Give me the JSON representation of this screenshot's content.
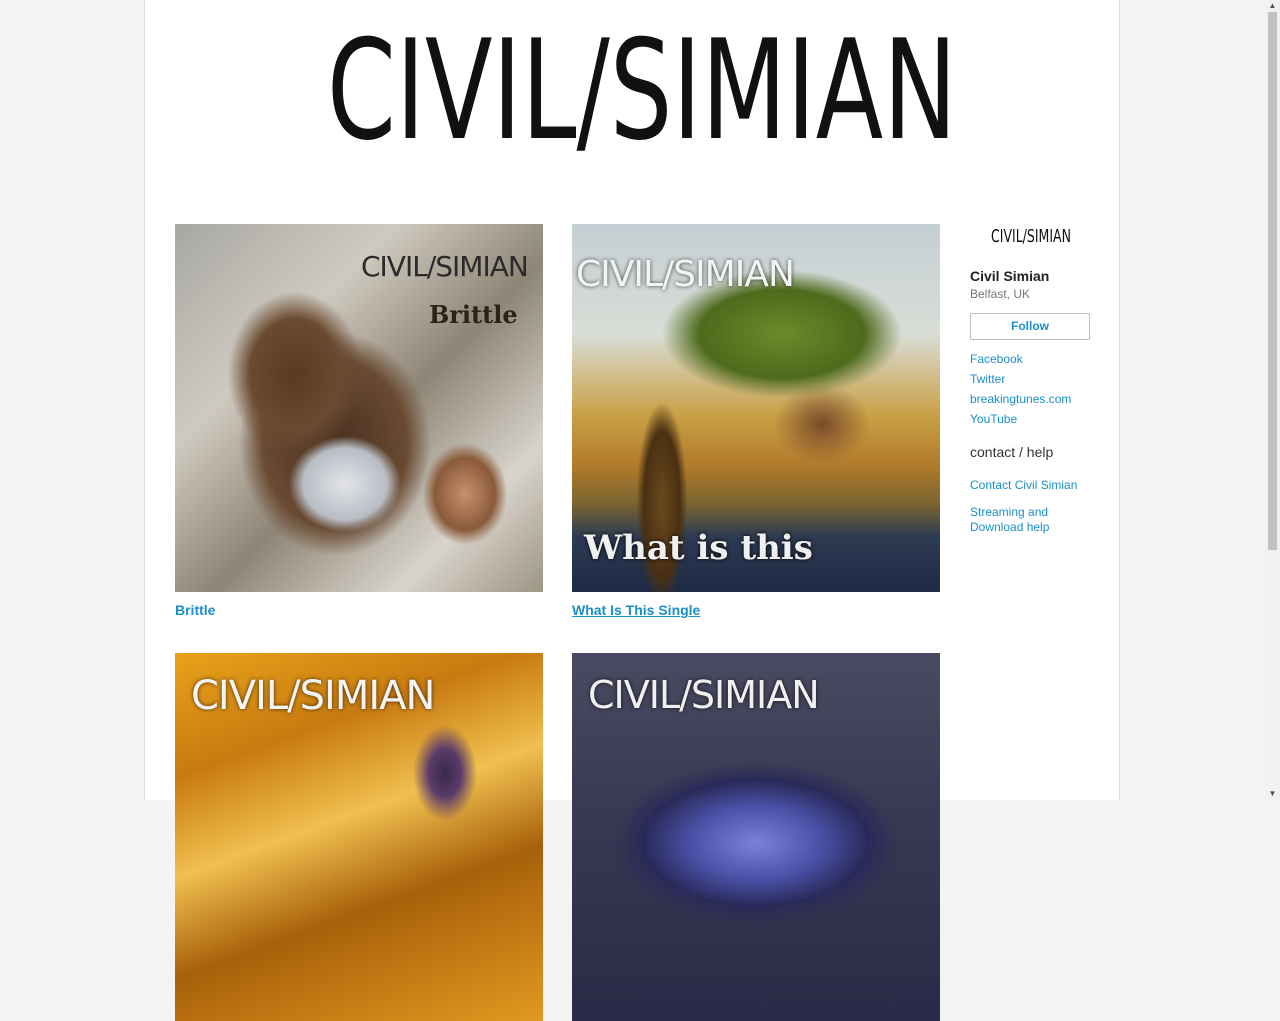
{
  "header": {
    "logo_text": "CIVIL/SIMIAN"
  },
  "albums": [
    {
      "title": "Brittle",
      "art_logo": "CIVIL/SIMIAN",
      "art_subtitle": "Brittle"
    },
    {
      "title": "What Is This Single",
      "art_logo": "CIVIL/SIMIAN",
      "art_subtitle": "What is this"
    },
    {
      "title": "",
      "art_logo": "CIVIL/SIMIAN"
    },
    {
      "title": "",
      "art_logo": "CIVIL/SIMIAN"
    }
  ],
  "sidebar": {
    "logo_text": "CIVIL/SIMIAN",
    "band_name": "Civil Simian",
    "location": "Belfast, UK",
    "follow_label": "Follow",
    "links": [
      "Facebook",
      "Twitter",
      "breakingtunes.com",
      "YouTube"
    ],
    "help_title": "contact / help",
    "contact_label": "Contact Civil Simian",
    "help_label": "Streaming and Download help"
  },
  "colors": {
    "link": "#1a8fc9",
    "background": "#f3f3f3"
  }
}
